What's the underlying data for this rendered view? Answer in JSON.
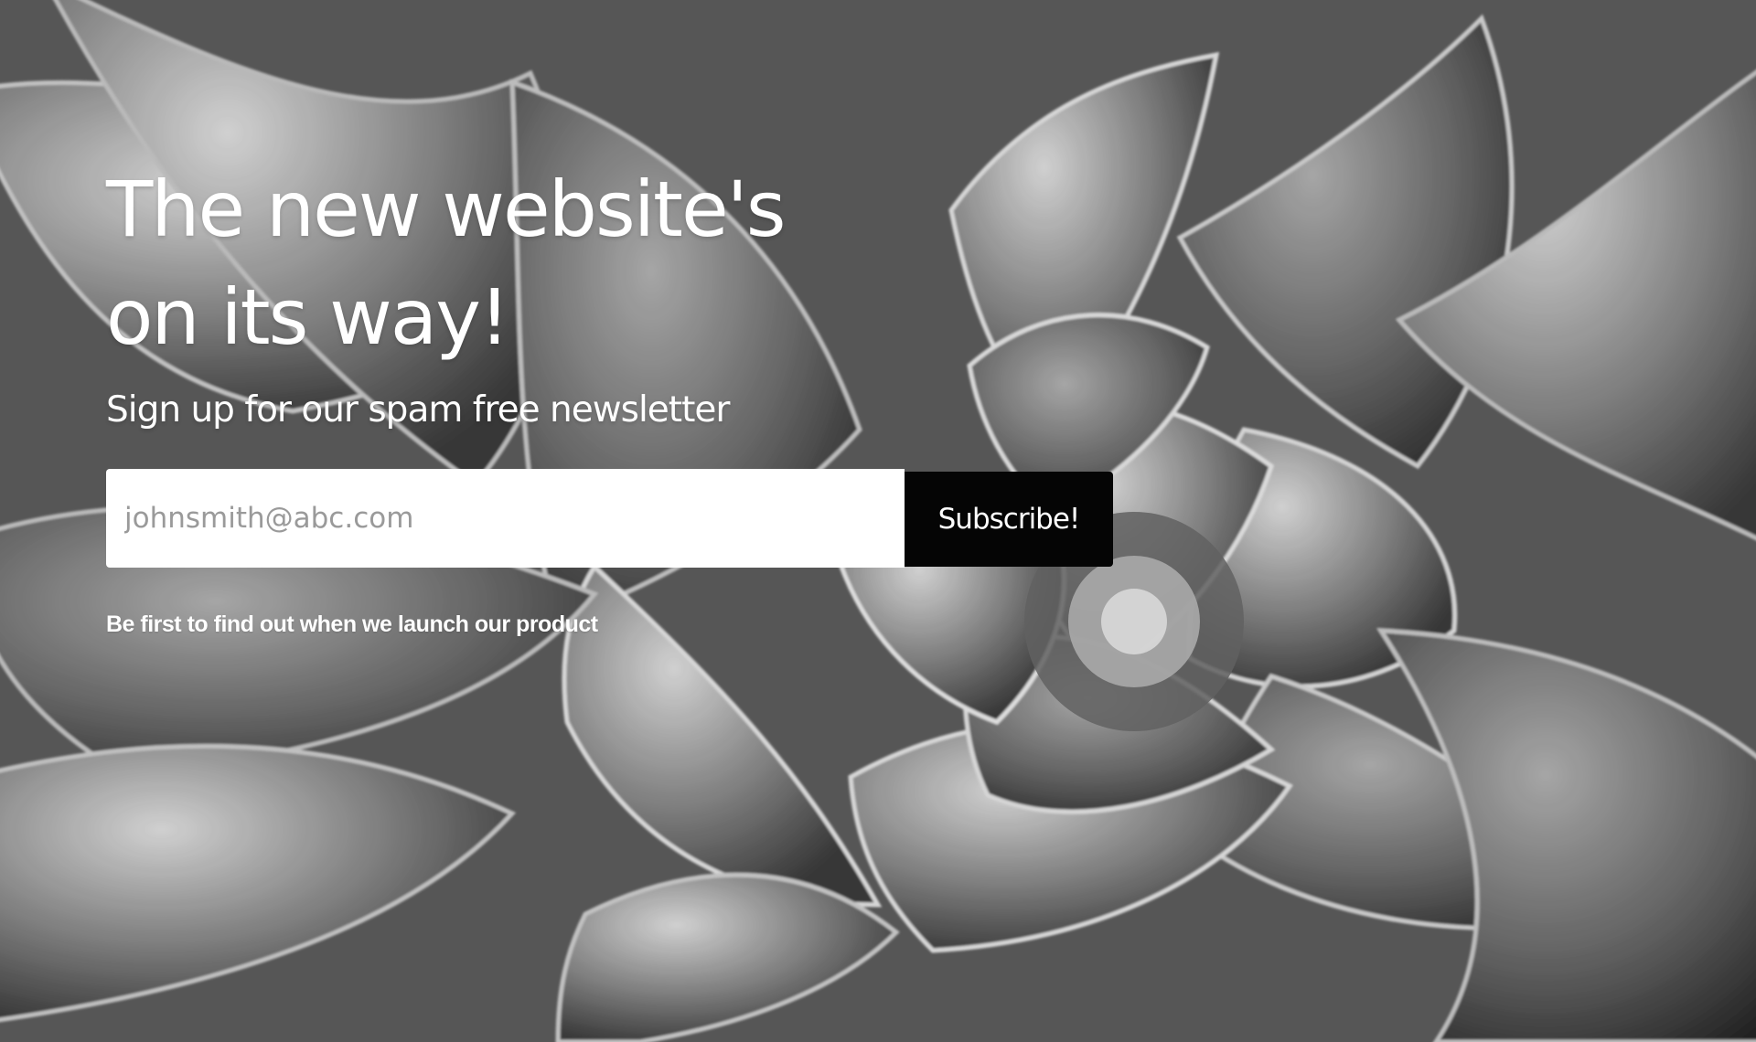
{
  "hero": {
    "headline_line_1": "The new website's",
    "headline_line_2": "on its way!",
    "subhead": "Sign up for our spam free newsletter"
  },
  "signup_form": {
    "email_placeholder": "johnsmith@abc.com",
    "subscribe_label": "Subscribe!"
  },
  "footer_note": "Be first to find out when we launch our product",
  "theme": {
    "text_color": "#ffffff",
    "button_color": "#050505",
    "input_background": "#ffffff",
    "background_style": "grayscale succulent photograph"
  }
}
